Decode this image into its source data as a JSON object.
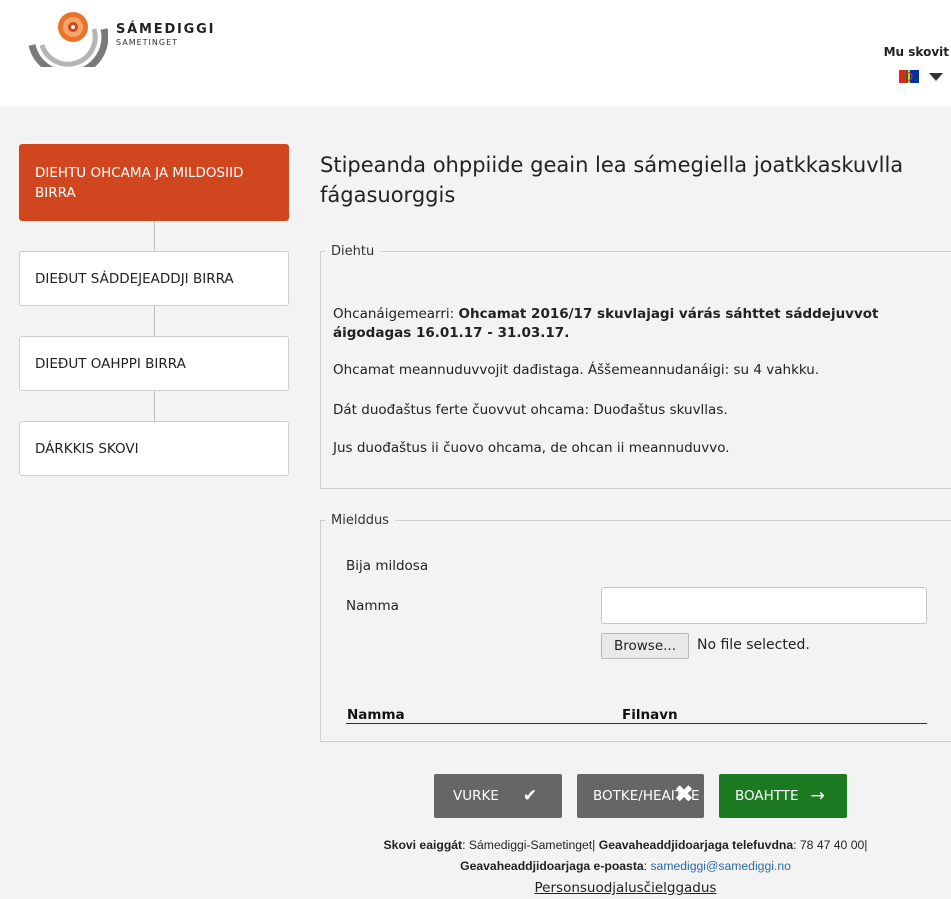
{
  "header": {
    "logo_main": "SÁMEDIGGI",
    "logo_sub": "SAMETINGET",
    "user_link": "Mu skovit"
  },
  "sidebar": {
    "steps": [
      {
        "label": "DIEHTU OHCAMA JA MILDOSIID BIRRA",
        "active": true
      },
      {
        "label": "DIEĐUT SÁDDEJEADDJI BIRRA",
        "active": false
      },
      {
        "label": "DIEĐUT OAHPPI BIRRA",
        "active": false
      },
      {
        "label": "DÁRKKIS SKOVI",
        "active": false
      }
    ]
  },
  "main": {
    "title": "Stipeanda ohppiide geain lea sámegiella joatkkaskuvlla fágasuorggis",
    "info": {
      "legend": "Diehtu",
      "deadline_label": "Ohcanáigemearri: ",
      "deadline_value": "Ohcamat 2016/17 skuvlajagi várás sáhttet sáddejuvvot áigodagas 16.01.17 - 31.03.17.",
      "processing": "Ohcamat meannuduvvojit dađistaga. Áššemeannudanáigi: su 4 vahkku.",
      "required_doc": "Dát duođaštus ferte čuovvut ohcama: Duođaštus skuvllas.",
      "warning": "Jus duođaštus ii čuovo ohcama, de ohcan ii meannuduvvo."
    },
    "attachments": {
      "legend": "Mielddus",
      "add_label": "Bija mildosa",
      "name_label": "Namma",
      "name_value": "",
      "browse_label": "Browse...",
      "no_file": "No file selected.",
      "columns": [
        "Namma",
        "Filnavn"
      ]
    },
    "buttons": {
      "save": "VURKE",
      "cancel": "BOTKE/HEAITTE",
      "next": "BOAHTTE"
    }
  },
  "footer": {
    "owner_label": "Skovi eaiggát",
    "owner_value": ": Sámediggi-Sametinget| ",
    "phone_label": "Geavaheaddjidoarjaga telefuvdna",
    "phone_value": ": 78 47 40 00|",
    "email_label": "Geavaheaddjidoarjaga e-poasta",
    "email_sep": ": ",
    "email_value": "samediggi@samediggi.no",
    "privacy_link": "Personsuodjalusčielggadus"
  },
  "colors": {
    "active_step": "#d0461e",
    "next_button": "#1c7a22",
    "neutral_button": "#666666",
    "background": "#f3f3f3"
  }
}
